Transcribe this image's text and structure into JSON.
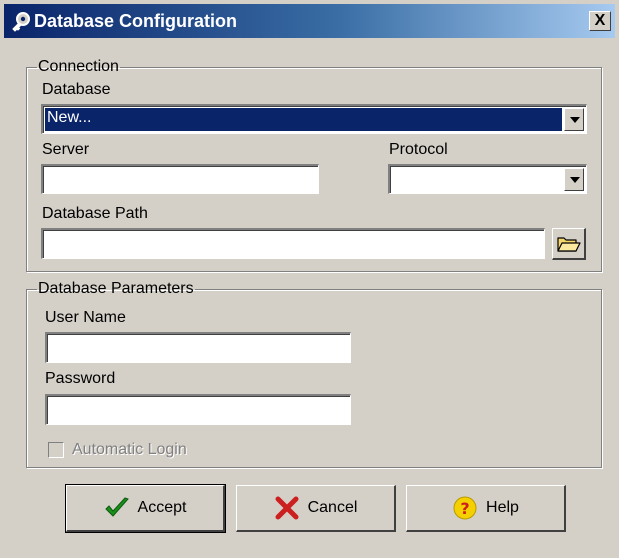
{
  "window": {
    "title": "Database Configuration",
    "close_symbol": "X"
  },
  "connection": {
    "group_label": "Connection",
    "database_label": "Database",
    "database_value": "New...",
    "server_label": "Server",
    "server_value": "",
    "protocol_label": "Protocol",
    "protocol_value": "",
    "path_label": "Database Path",
    "path_value": ""
  },
  "parameters": {
    "group_label": "Database Parameters",
    "username_label": "User Name",
    "username_value": "",
    "password_label": "Password",
    "password_value": "",
    "auto_login_label": "Automatic Login",
    "auto_login_checked": false
  },
  "buttons": {
    "accept": "Accept",
    "cancel": "Cancel",
    "help": "Help"
  },
  "icons": {
    "title": "key-icon",
    "folder": "folder-open-icon",
    "accept": "checkmark-icon",
    "cancel": "x-icon",
    "help": "question-icon"
  },
  "colors": {
    "title_bar": "#0a246a",
    "selection": "#0a246a",
    "accept_green": "#1a8f1a",
    "cancel_red": "#cc1f1f",
    "help_yellow": "#f5d000",
    "help_red": "#cc1f1f"
  }
}
